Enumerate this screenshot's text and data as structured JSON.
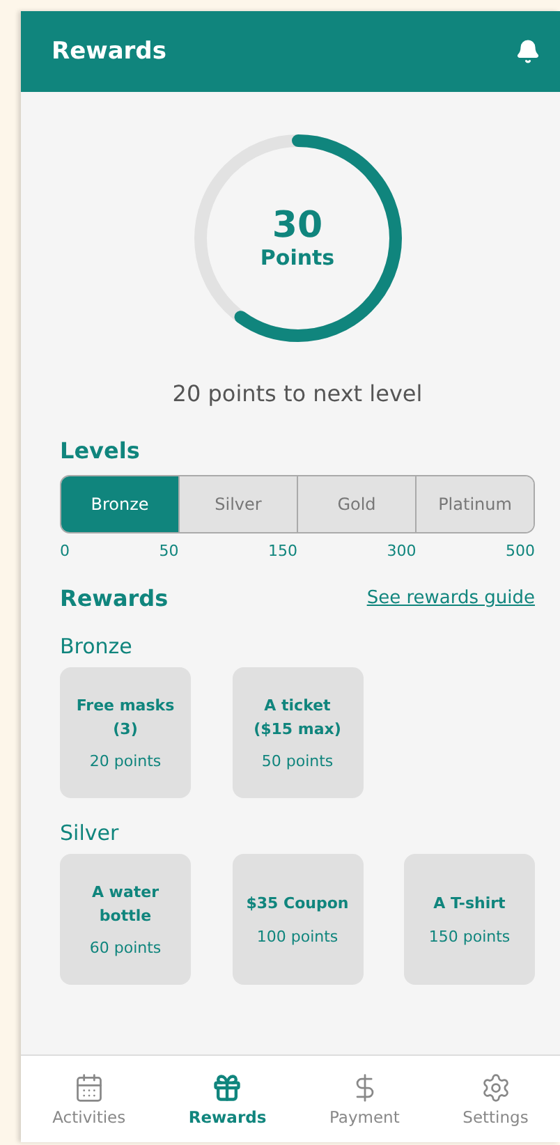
{
  "header": {
    "title": "Rewards"
  },
  "progress": {
    "value": "30",
    "unit": "Points",
    "level": 0.6,
    "caption": "20 points to next level"
  },
  "levels": {
    "title": "Levels",
    "tabs": [
      {
        "label": "Bronze",
        "selected": true
      },
      {
        "label": "Silver",
        "selected": false
      },
      {
        "label": "Gold",
        "selected": false
      },
      {
        "label": "Platinum",
        "selected": false
      }
    ],
    "ticks": [
      "0",
      "50",
      "150",
      "300",
      "500"
    ]
  },
  "rewards": {
    "title": "Rewards",
    "link": "See rewards guide",
    "groups": [
      {
        "name": "Bronze",
        "items": [
          {
            "title": "Free masks (3)",
            "points": "20 points"
          },
          {
            "title": "A ticket ($15 max)",
            "points": "50 points"
          }
        ]
      },
      {
        "name": "Silver",
        "items": [
          {
            "title": "A water bottle",
            "points": "60 points"
          },
          {
            "title": "$35 Coupon",
            "points": "100 points"
          },
          {
            "title": "A T-shirt",
            "points": "150 points"
          }
        ]
      }
    ]
  },
  "nav": [
    {
      "label": "Activities",
      "selected": false
    },
    {
      "label": "Rewards",
      "selected": true
    },
    {
      "label": "Payment",
      "selected": false
    },
    {
      "label": "Settings",
      "selected": false
    }
  ]
}
